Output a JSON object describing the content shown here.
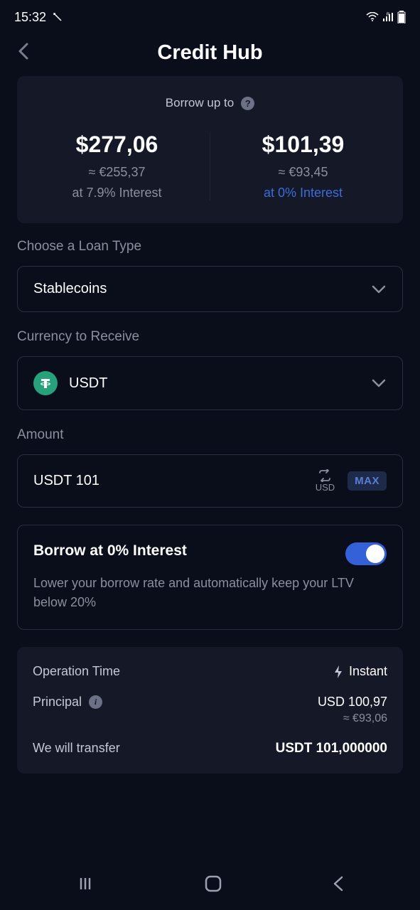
{
  "status": {
    "time": "15:32"
  },
  "header": {
    "title": "Credit Hub"
  },
  "borrow_card": {
    "label": "Borrow up to",
    "left": {
      "amount": "$277,06",
      "approx": "≈ €255,37",
      "interest": "at 7.9% Interest"
    },
    "right": {
      "amount": "$101,39",
      "approx": "≈ €93,45",
      "interest": "at 0% Interest"
    }
  },
  "loan_type": {
    "label": "Choose a Loan Type",
    "value": "Stablecoins"
  },
  "currency": {
    "label": "Currency to Receive",
    "value": "USDT"
  },
  "amount": {
    "label": "Amount",
    "value": "USDT 101",
    "switch_label": "USD",
    "max": "MAX"
  },
  "toggle": {
    "title": "Borrow at 0% Interest",
    "desc": "Lower your borrow rate and automatically keep your LTV below 20%"
  },
  "summary": {
    "op_time_label": "Operation Time",
    "op_time_value": "Instant",
    "principal_label": "Principal",
    "principal_value": "USD 100,97",
    "principal_approx": "≈ €93,06",
    "transfer_label": "We will transfer",
    "transfer_value": "USDT 101,000000"
  }
}
